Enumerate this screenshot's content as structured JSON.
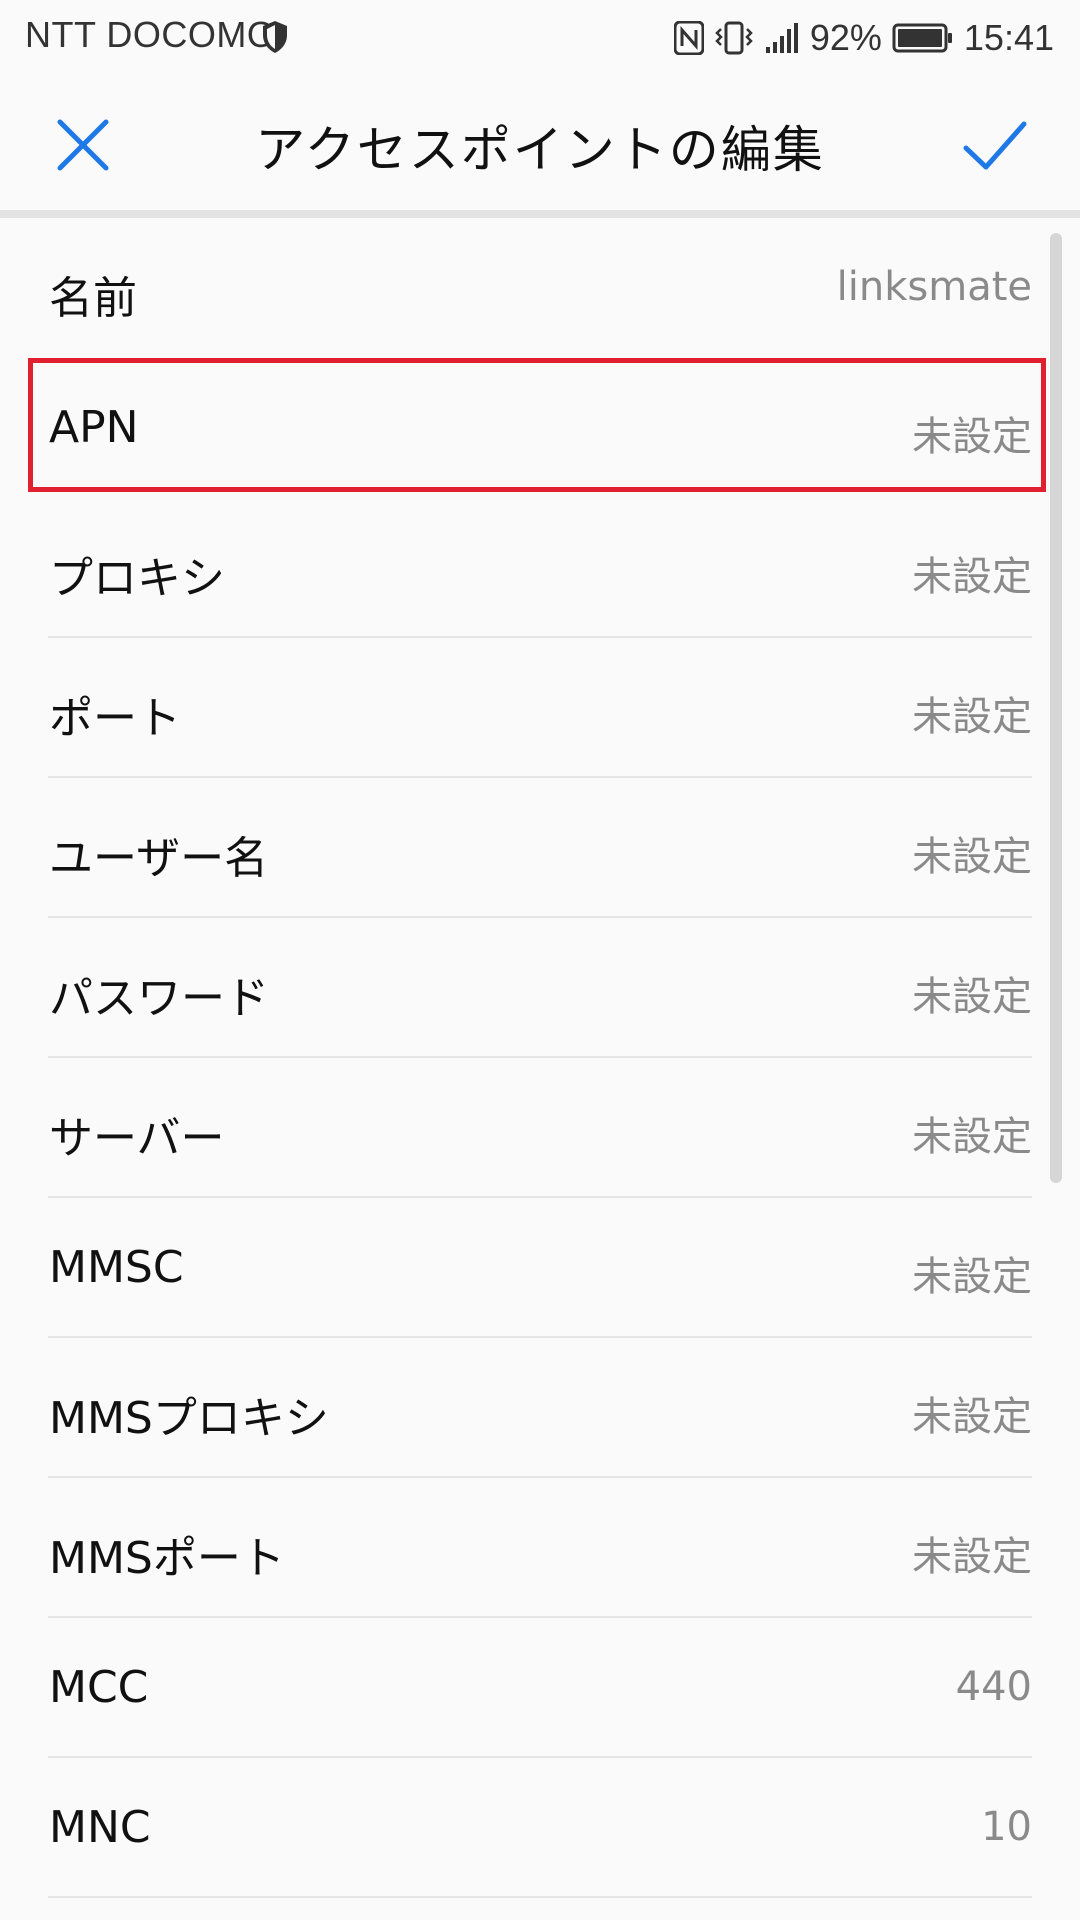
{
  "status_bar": {
    "carrier": "NTT DOCOMO",
    "battery_percent": "92%",
    "time": "15:41",
    "icons": [
      "shield-icon",
      "nfc-icon",
      "vibrate-icon",
      "signal-icon",
      "battery-icon"
    ]
  },
  "app_bar": {
    "title": "アクセスポイントの編集",
    "close_icon": "close-icon",
    "confirm_icon": "check-icon",
    "accent_color": "#1e78e6"
  },
  "fields": [
    {
      "label": "名前",
      "value": "linksmate"
    },
    {
      "label": "APN",
      "value": "未設定"
    },
    {
      "label": "プロキシ",
      "value": "未設定"
    },
    {
      "label": "ポート",
      "value": "未設定"
    },
    {
      "label": "ユーザー名",
      "value": "未設定"
    },
    {
      "label": "パスワード",
      "value": "未設定"
    },
    {
      "label": "サーバー",
      "value": "未設定"
    },
    {
      "label": "MMSC",
      "value": "未設定"
    },
    {
      "label": "MMSプロキシ",
      "value": "未設定"
    },
    {
      "label": "MMSポート",
      "value": "未設定"
    },
    {
      "label": "MCC",
      "value": "440"
    },
    {
      "label": "MNC",
      "value": "10"
    }
  ],
  "highlight_color": "#e0202f"
}
